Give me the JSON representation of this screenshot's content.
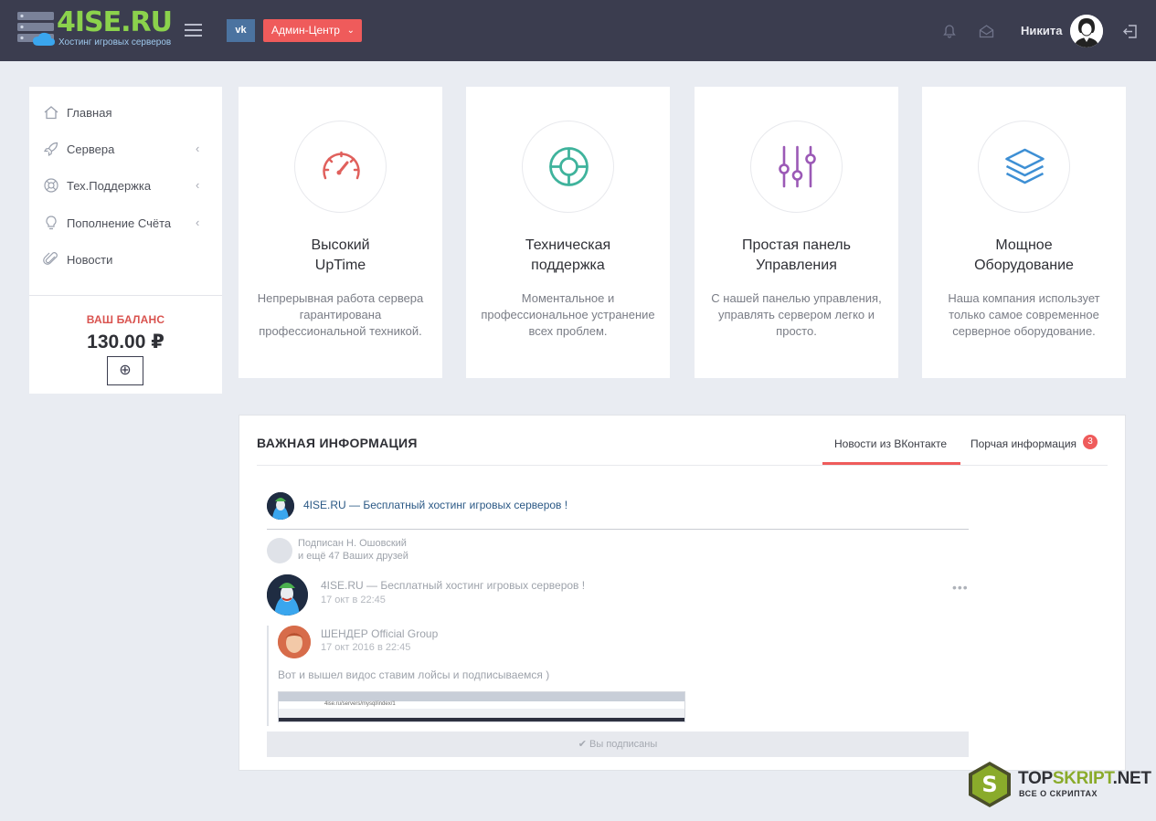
{
  "header": {
    "logo_text": "4ISE.RU",
    "logo_subtitle": "Хостинг игровых серверов",
    "vk_label": "vk",
    "admin_label": "Админ-Центр",
    "username": "Никита"
  },
  "sidebar": {
    "items": [
      {
        "label": "Главная",
        "icon": "home-icon"
      },
      {
        "label": "Сервера",
        "icon": "rocket-icon"
      },
      {
        "label": "Тех.Поддержка",
        "icon": "lifebuoy-icon"
      },
      {
        "label": "Пополнение Счёта",
        "icon": "bulb-icon"
      },
      {
        "label": "Новости",
        "icon": "paperclip-icon"
      }
    ],
    "balance_title": "ВАШ БАЛАНС",
    "balance_value": "130.00 ₽"
  },
  "features": [
    {
      "title_line1": "Высокий",
      "title_line2": "UpTime",
      "desc": "Непрерывная работа сервера гарантирована профессиональной техникой.",
      "icon": "speedometer-icon",
      "color": "#e0605c"
    },
    {
      "title_line1": "Техническая",
      "title_line2": "поддержка",
      "desc": "Моментальное и профессиональное устранение всех проблем.",
      "icon": "lifebuoy-icon",
      "color": "#3fb39c"
    },
    {
      "title_line1": "Простая панель",
      "title_line2": "Управления",
      "desc": "С нашей панелью управления, управлять сервером легко и просто.",
      "icon": "sliders-icon",
      "color": "#9b59b6"
    },
    {
      "title_line1": "Мощное",
      "title_line2": "Оборудование",
      "desc": "Наша компания использует только самое современное серверное оборудование.",
      "icon": "layers-icon",
      "color": "#3d8fd4"
    }
  ],
  "info": {
    "title": "ВАЖНАЯ ИНФОРМАЦИЯ",
    "tab_vk": "Новости из ВКонтакте",
    "tab_other": "Порчая информация",
    "badge": "3"
  },
  "vk": {
    "group_name": "4ISE.RU — Бесплатный хостинг игровых серверов !",
    "subscribed_line1": "Подписан Н. Ошовский",
    "subscribed_line2": "и ещё 47 Ваших друзей",
    "post_author": "4ISE.RU — Бесплатный хостинг игровых серверов !",
    "post_date": "17 окт в 22:45",
    "repost_author": "ШЕНДЕР Official Group",
    "repost_date": "17 окт 2016 в 22:45",
    "post_text": "Вот и вышел видос ставим лойсы и подписываемся )",
    "screenshot_url": "4ise.ru/servers/mysql/index/1",
    "subscribed_button": "Вы подписаны"
  },
  "watermark": {
    "line1_a": "TOP",
    "line1_b": "SKRIPT",
    "line1_c": ".NET",
    "line2": "ВСЕ О СКРИПТАХ"
  }
}
